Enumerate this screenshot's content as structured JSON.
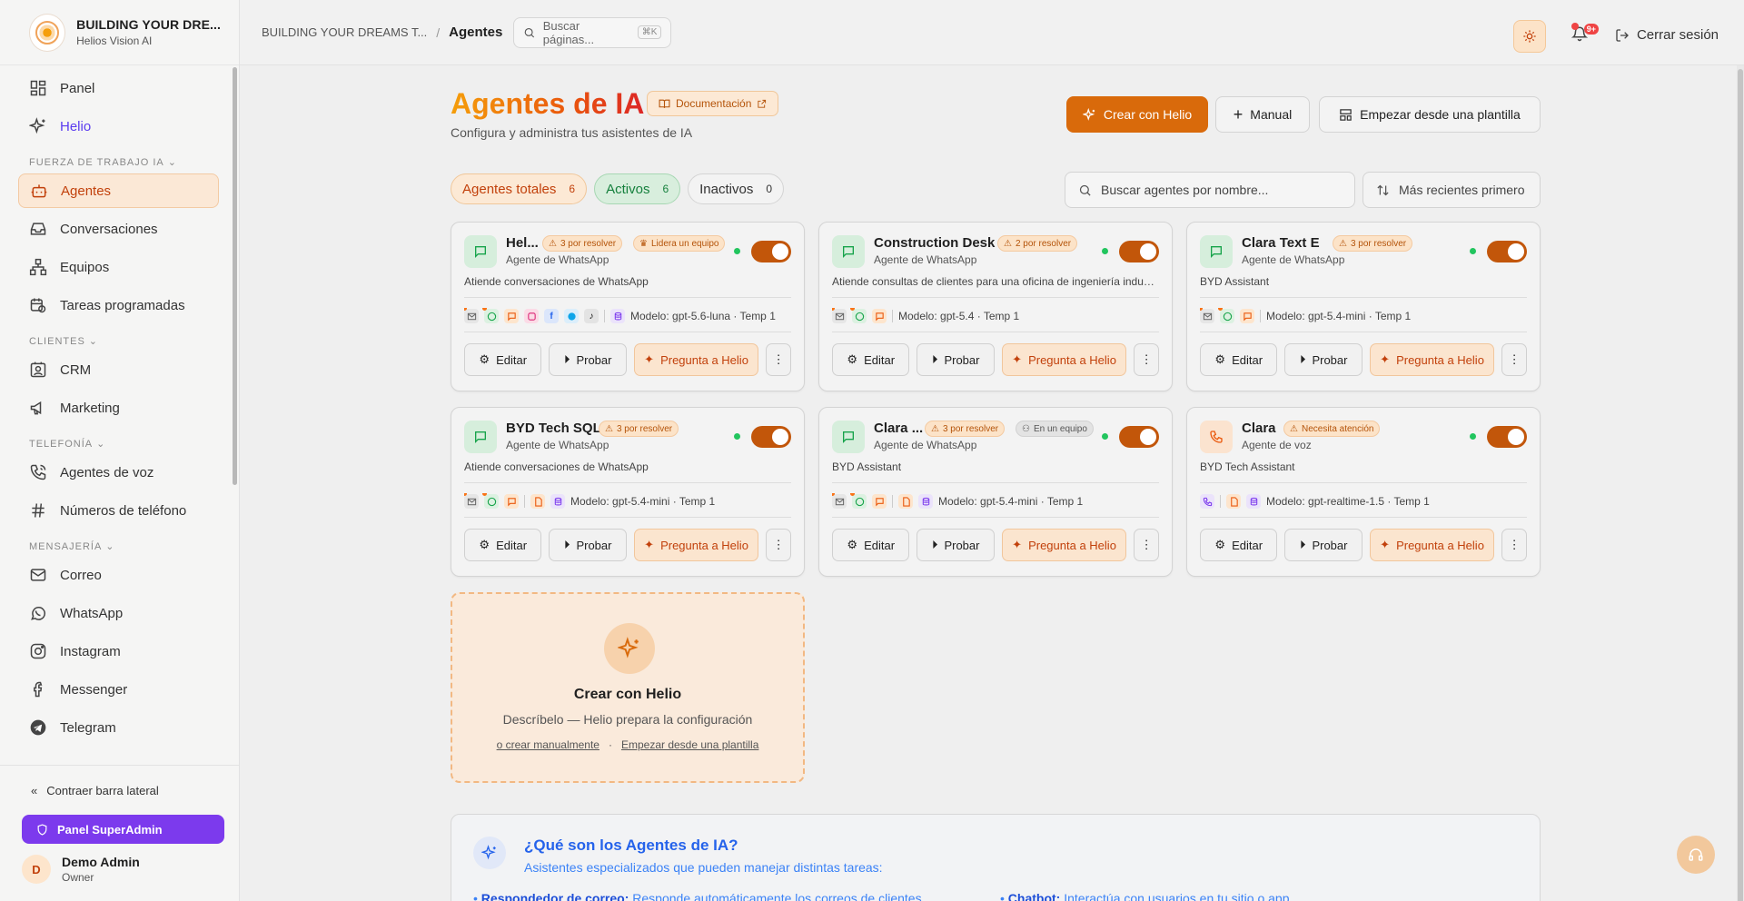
{
  "brand": {
    "title": "BUILDING YOUR DRE...",
    "subtitle": "Helios Vision AI"
  },
  "nav": {
    "panel": "Panel",
    "helio": "Helio",
    "section_workforce": "FUERZA DE TRABAJO IA",
    "agents": "Agentes",
    "conversations": "Conversaciones",
    "teams": "Equipos",
    "scheduled": "Tareas programadas",
    "section_clients": "CLIENTES",
    "crm": "CRM",
    "marketing": "Marketing",
    "section_phone": "TELEFONÍA",
    "voice_agents": "Agentes de voz",
    "phone_numbers": "Números de teléfono",
    "section_messaging": "MENSAJERÍA",
    "email": "Correo",
    "whatsapp": "WhatsApp",
    "instagram": "Instagram",
    "messenger": "Messenger",
    "telegram": "Telegram"
  },
  "sidebar_bottom": {
    "collapse": "Contraer barra lateral",
    "superadmin": "Panel SuperAdmin",
    "user_initial": "D",
    "user_name": "Demo Admin",
    "user_role": "Owner"
  },
  "topbar": {
    "crumb_org": "BUILDING YOUR DREAMS T...",
    "crumb_sep": "/",
    "crumb_page": "Agentes",
    "search_placeholder": "Buscar páginas...",
    "search_kbd": "⌘K",
    "notif_badge": "9+",
    "logout": "Cerrar sesión"
  },
  "header": {
    "title": "Agentes de IA",
    "docs": "Documentación",
    "subtitle": "Configura y administra tus asistentes de IA",
    "btn_create_helio": "Crear con Helio",
    "btn_manual": "Manual",
    "btn_template": "Empezar desde una plantilla"
  },
  "filters": {
    "total_label": "Agentes totales",
    "total_count": "6",
    "active_label": "Activos",
    "active_count": "6",
    "inactive_label": "Inactivos",
    "inactive_count": "0",
    "search_placeholder": "Buscar agentes por nombre...",
    "sort": "Más recientes primero"
  },
  "card_buttons": {
    "edit": "Editar",
    "test": "Probar",
    "ask": "Pregunta a Helio"
  },
  "agents": [
    {
      "name": "Hel...",
      "chip1": "3 por resolver",
      "chip2": "Lidera un equipo",
      "type": "Agente de WhatsApp",
      "desc": "Atiende conversaciones de WhatsApp",
      "model": "Modelo: gpt-5.6-luna · Temp 1"
    },
    {
      "name": "Construction Desk",
      "chip1": "2 por resolver",
      "type": "Agente de WhatsApp",
      "desc": "Atiende consultas de clientes para una oficina de ingeniería industrial",
      "model": "Modelo: gpt-5.4 · Temp 1"
    },
    {
      "name": "Clara Text E",
      "chip1": "3 por resolver",
      "type": "Agente de WhatsApp",
      "desc": "BYD Assistant",
      "model": "Modelo: gpt-5.4-mini · Temp 1"
    },
    {
      "name": "BYD Tech SQL",
      "chip1": "3 por resolver",
      "type": "Agente de WhatsApp",
      "desc": "Atiende conversaciones de WhatsApp",
      "model": "Modelo: gpt-5.4-mini · Temp 1"
    },
    {
      "name": "Clara ...",
      "chip1": "3 por resolver",
      "chip2": "En un equipo",
      "type": "Agente de WhatsApp",
      "desc": "BYD Assistant",
      "model": "Modelo: gpt-5.4-mini · Temp 1"
    },
    {
      "name": "Clara",
      "chip1": "Necesita atención",
      "type": "Agente de voz",
      "desc": "BYD Tech Assistant",
      "model": "Modelo: gpt-realtime-1.5 · Temp 1"
    }
  ],
  "create_card": {
    "title": "Crear con Helio",
    "subtitle": "Descríbelo — Helio prepara la configuración",
    "link_manual": "o crear manualmente",
    "dot": "·",
    "link_template": "Empezar desde una plantilla"
  },
  "info": {
    "title": "¿Qué son los Agentes de IA?",
    "subtitle": "Asistentes especializados que pueden manejar distintas tareas:",
    "b1_label": "Respondedor de correo:",
    "b1_text": "Responde automáticamente los correos de clientes",
    "b2_label": "Chatbot:",
    "b2_text": "Interactúa con usuarios en tu sitio o app"
  },
  "colors": {
    "accent": "#d96a0b",
    "active_green": "#22c55e",
    "superadmin": "#7c3aed",
    "helio_purple": "#5b3cf0"
  }
}
